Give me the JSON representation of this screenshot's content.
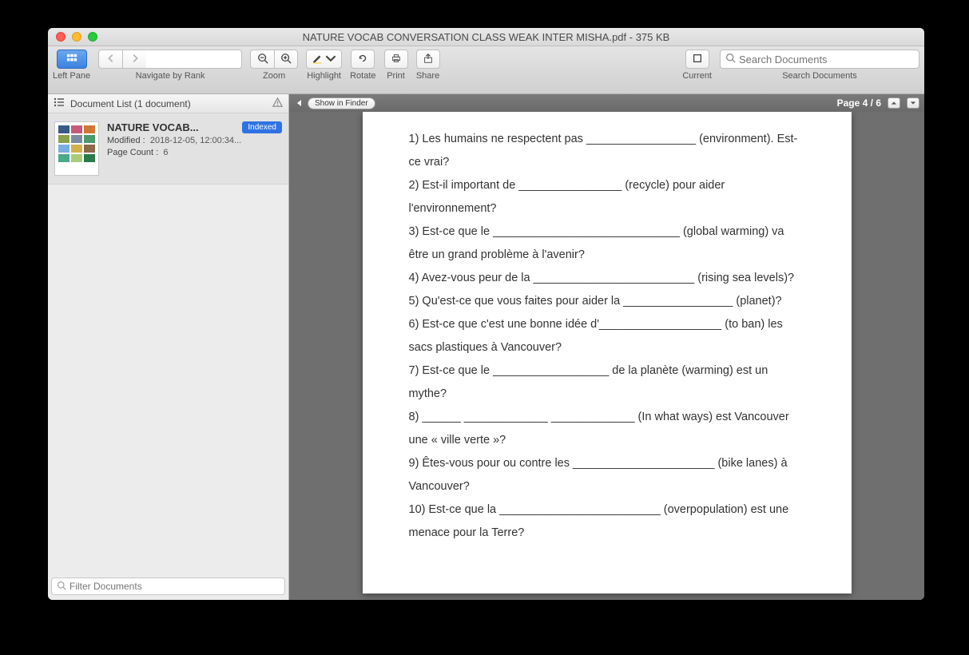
{
  "window": {
    "title": "NATURE VOCAB CONVERSATION CLASS WEAK INTER MISHA.pdf - 375 KB"
  },
  "toolbar": {
    "left_pane_label": "Left Pane",
    "navigate_label": "Navigate by Rank",
    "zoom_label": "Zoom",
    "highlight_label": "Highlight",
    "rotate_label": "Rotate",
    "print_label": "Print",
    "share_label": "Share",
    "current_label": "Current",
    "search_label": "Search Documents",
    "search_placeholder": "Search Documents"
  },
  "sidebar": {
    "header_label": "Document List (1 document)",
    "finder_button": "Show in Finder",
    "doc": {
      "title": "NATURE VOCAB...",
      "badge": "Indexed",
      "modified_key": "Modified :",
      "modified_val": "2018-12-05, 12:00:34...",
      "pagecount_key": "Page Count :",
      "pagecount_val": "6"
    },
    "filter_placeholder": "Filter Documents"
  },
  "page": {
    "indicator": "Page 4 / 6",
    "body": [
      "1) Les humains ne respectent pas _________________ (environment). Est-ce vrai?",
      "2) Est-il important de ________________ (recycle) pour aider l'environnement?",
      "3) Est-ce que le _____________________________ (global warming) va être un grand problème à l'avenir?",
      "4) Avez-vous peur de la _________________________ (rising sea levels)?",
      "5) Qu'est-ce que vous faites pour aider la _________________ (planet)?",
      "6) Est-ce que c'est une bonne idée d'___________________ (to ban) les sacs plastiques à Vancouver?",
      "7) Est-ce que le __________________ de la planète (warming) est un mythe?",
      "8) ______ _____________ _____________ (In what ways) est Vancouver une « ville verte »?",
      "9) Êtes-vous pour ou contre les ______________________ (bike lanes) à Vancouver?",
      "10) Est-ce que la _________________________ (overpopulation) est une menace pour la Terre?"
    ]
  }
}
